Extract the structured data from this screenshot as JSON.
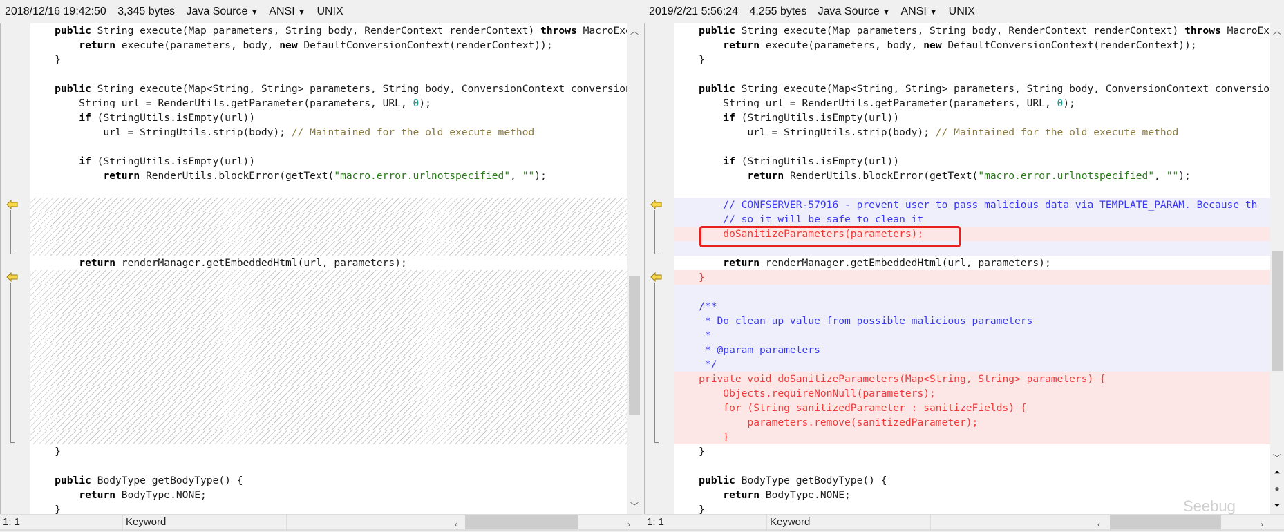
{
  "left": {
    "date": "2018/12/16 19:42:50",
    "size": "3,345 bytes",
    "language": "Java Source",
    "encoding": "ANSI",
    "eol": "UNIX",
    "position": "1: 1",
    "token": "Keyword"
  },
  "right": {
    "date": "2019/2/21 5:56:24",
    "size": "4,255 bytes",
    "language": "Java Source",
    "encoding": "ANSI",
    "eol": "UNIX",
    "position": "1: 1",
    "token": "Keyword"
  },
  "colors": {
    "added_bg": "#fde6e6",
    "changed_bg": "#efeefb",
    "added_text": "#f03a3a",
    "highlight_box": "#e82020"
  },
  "icons": {
    "dropdown": "triangle-down",
    "diff_marker": "yellow-arrow-left",
    "watermark": "Seebug"
  },
  "left_rows": [
    "n",
    "n",
    "n",
    "n",
    "n",
    "n",
    "n",
    "n",
    "n",
    "n",
    "n",
    "n",
    "h",
    "h",
    "h",
    "h",
    "n",
    "h",
    "h",
    "h",
    "h",
    "h",
    "h",
    "h",
    "h",
    "h",
    "h",
    "h",
    "h",
    "n",
    "n",
    "n",
    "n",
    "n"
  ],
  "right_rows": [
    "n",
    "n",
    "n",
    "n",
    "n",
    "n",
    "n",
    "n",
    "n",
    "n",
    "n",
    "n",
    "m",
    "m",
    "a",
    "m",
    "n",
    "a",
    "m",
    "m",
    "m",
    "m",
    "m",
    "m",
    "a",
    "a",
    "a",
    "a",
    "a",
    "n",
    "n",
    "n",
    "n",
    "n"
  ],
  "left_lines": [
    [
      [
        "",
        "    "
      ],
      [
        "kw",
        "public"
      ],
      [
        "",
        " String execute(Map parameters, String body, RenderContext renderContext) "
      ],
      [
        "kw",
        "throws"
      ],
      [
        "",
        " MacroExecutionException {"
      ]
    ],
    [
      [
        "",
        "        "
      ],
      [
        "kw",
        "return"
      ],
      [
        "",
        " execute(parameters, body, "
      ],
      [
        "kw",
        "new"
      ],
      [
        "",
        " DefaultConversionContext(renderContext));"
      ]
    ],
    [
      [
        "",
        "    }"
      ]
    ],
    [],
    [
      [
        "",
        "    "
      ],
      [
        "kw",
        "public"
      ],
      [
        "",
        " String execute(Map<String, String> parameters, String body, ConversionContext conversionContext)"
      ]
    ],
    [
      [
        "",
        "        String url = RenderUtils.getParameter(parameters, URL, "
      ],
      [
        "num",
        "0"
      ],
      [
        "",
        ");"
      ]
    ],
    [
      [
        "",
        "        "
      ],
      [
        "kw",
        "if"
      ],
      [
        "",
        " (StringUtils.isEmpty(url))"
      ]
    ],
    [
      [
        "",
        "            url = StringUtils.strip(body); "
      ],
      [
        "cmt",
        "// Maintained for the old execute method"
      ]
    ],
    [],
    [
      [
        "",
        "        "
      ],
      [
        "kw",
        "if"
      ],
      [
        "",
        " (StringUtils.isEmpty(url))"
      ]
    ],
    [
      [
        "",
        "            "
      ],
      [
        "kw",
        "return"
      ],
      [
        "",
        " RenderUtils.blockError(getText("
      ],
      [
        "str",
        "\"macro.error.urlnotspecified\""
      ],
      [
        "",
        ", "
      ],
      [
        "str",
        "\"\""
      ],
      [
        "",
        ");"
      ]
    ],
    [],
    [],
    [],
    [],
    [],
    [
      [
        "",
        "        "
      ],
      [
        "kw",
        "return"
      ],
      [
        "",
        " renderManager.getEmbeddedHtml(url, parameters);"
      ]
    ],
    [],
    [],
    [],
    [],
    [],
    [],
    [],
    [],
    [],
    [],
    [],
    [],
    [
      [
        "",
        "    }"
      ]
    ],
    [],
    [
      [
        "",
        "    "
      ],
      [
        "kw",
        "public"
      ],
      [
        "",
        " BodyType getBodyType() {"
      ]
    ],
    [
      [
        "",
        "        "
      ],
      [
        "kw",
        "return"
      ],
      [
        "",
        " BodyType.NONE;"
      ]
    ],
    [
      [
        "",
        "    }"
      ]
    ]
  ],
  "right_lines": [
    [
      [
        "",
        "    "
      ],
      [
        "kw",
        "public"
      ],
      [
        "",
        " String execute(Map parameters, String body, RenderContext renderContext) "
      ],
      [
        "kw",
        "throws"
      ],
      [
        "",
        " MacroExecutionException {"
      ]
    ],
    [
      [
        "",
        "        "
      ],
      [
        "kw",
        "return"
      ],
      [
        "",
        " execute(parameters, body, "
      ],
      [
        "kw",
        "new"
      ],
      [
        "",
        " DefaultConversionContext(renderContext));"
      ]
    ],
    [
      [
        "",
        "    }"
      ]
    ],
    [],
    [
      [
        "",
        "    "
      ],
      [
        "kw",
        "public"
      ],
      [
        "",
        " String execute(Map<String, String> parameters, String body, ConversionContext conversionContext)"
      ]
    ],
    [
      [
        "",
        "        String url = RenderUtils.getParameter(parameters, URL, "
      ],
      [
        "num",
        "0"
      ],
      [
        "",
        ");"
      ]
    ],
    [
      [
        "",
        "        "
      ],
      [
        "kw",
        "if"
      ],
      [
        "",
        " (StringUtils.isEmpty(url))"
      ]
    ],
    [
      [
        "",
        "            url = StringUtils.strip(body); "
      ],
      [
        "cmt",
        "// Maintained for the old execute method"
      ]
    ],
    [],
    [
      [
        "",
        "        "
      ],
      [
        "kw",
        "if"
      ],
      [
        "",
        " (StringUtils.isEmpty(url))"
      ]
    ],
    [
      [
        "",
        "            "
      ],
      [
        "kw",
        "return"
      ],
      [
        "",
        " RenderUtils.blockError(getText("
      ],
      [
        "str",
        "\"macro.error.urlnotspecified\""
      ],
      [
        "",
        ", "
      ],
      [
        "str",
        "\"\""
      ],
      [
        "",
        ");"
      ]
    ],
    [],
    [
      [
        "doc",
        "        // CONFSERVER-57916 - prevent user to pass malicious data via TEMPLATE_PARAM. Because th"
      ]
    ],
    [
      [
        "doc",
        "        // so it will be safe to clean it"
      ]
    ],
    [
      [
        "red",
        "        doSanitizeParameters(parameters);"
      ]
    ],
    [],
    [
      [
        "",
        "        "
      ],
      [
        "kw",
        "return"
      ],
      [
        "",
        " renderManager.getEmbeddedHtml(url, parameters);"
      ]
    ],
    [
      [
        "red",
        "    }"
      ]
    ],
    [],
    [
      [
        "doc",
        "    /**"
      ]
    ],
    [
      [
        "doc",
        "     * Do clean up value from possible malicious parameters"
      ]
    ],
    [
      [
        "doc",
        "     *"
      ]
    ],
    [
      [
        "doc",
        "     * @param parameters"
      ]
    ],
    [
      [
        "doc",
        "     */"
      ]
    ],
    [
      [
        "red",
        "    private void doSanitizeParameters(Map<String, String> parameters) {"
      ]
    ],
    [
      [
        "red",
        "        Objects.requireNonNull(parameters);"
      ]
    ],
    [
      [
        "red",
        "        for (String sanitizedParameter : sanitizeFields) {"
      ]
    ],
    [
      [
        "red",
        "            parameters.remove(sanitizedParameter);"
      ]
    ],
    [
      [
        "red",
        "        }"
      ]
    ],
    [
      [
        "",
        "    }"
      ]
    ],
    [],
    [
      [
        "",
        "    "
      ],
      [
        "kw",
        "public"
      ],
      [
        "",
        " BodyType getBodyType() {"
      ]
    ],
    [
      [
        "",
        "        "
      ],
      [
        "kw",
        "return"
      ],
      [
        "",
        " BodyType.NONE;"
      ]
    ],
    [
      [
        "",
        "    }"
      ]
    ]
  ]
}
